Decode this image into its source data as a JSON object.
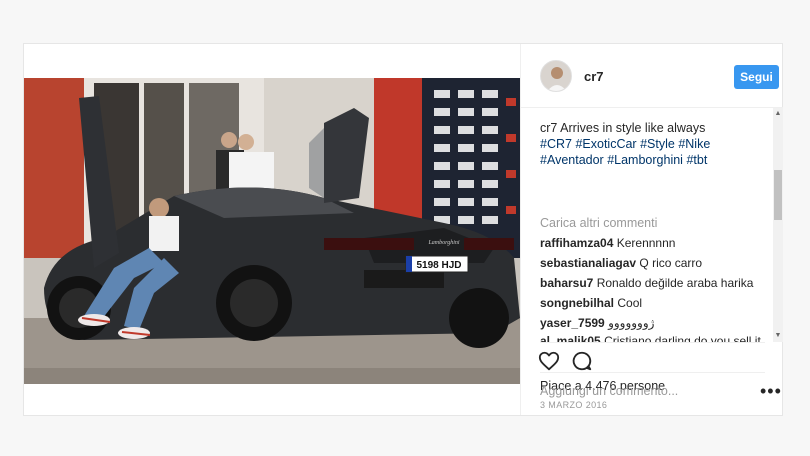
{
  "post": {
    "username": "cr7",
    "follow_label": "Segui",
    "caption": {
      "text": "Arrives in style like always",
      "hashtags": [
        "#CR7",
        "#ExoticCar",
        "#Style",
        "#Nike",
        "#Aventador",
        "#Lamborghini",
        "#tbt"
      ]
    },
    "load_more": "Carica altri commenti",
    "comments": [
      {
        "user": "raffihamza04",
        "text": "Kerennnnn"
      },
      {
        "user": "sebastianaliagav",
        "text": "Q rico carro"
      },
      {
        "user": "baharsu7",
        "text": "Ronaldo değilde araba harika"
      },
      {
        "user": "songnebilhal",
        "text": "Cool"
      },
      {
        "user": "yaser_7599",
        "text": "ژووووووو"
      },
      {
        "user": "al_malik05",
        "text": "Cristiano darling do you sell it"
      }
    ],
    "likes": "Piace a 4.476 persone",
    "date": "3 MARZO 2016",
    "comment_placeholder": "Aggiungi un commento...",
    "more_label": "•••",
    "photo": {
      "plate": "5198 HJD",
      "badge": "Lamborghini"
    }
  },
  "icons": {
    "like": "heart-icon",
    "comment": "comment-bubble-icon",
    "more": "more-options-icon"
  },
  "colors": {
    "follow": "#3897f0",
    "hashtag": "#003569",
    "muted": "#999999"
  }
}
